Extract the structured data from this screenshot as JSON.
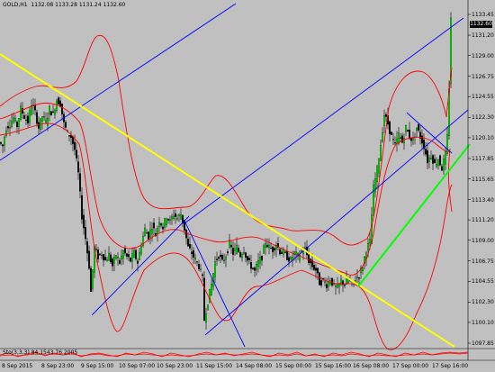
{
  "header": {
    "symbol_tf": "GOLD,H1",
    "ohlc": "1132.08 1133.28 1131.24 1132.60"
  },
  "price_axis": {
    "ticks": [
      "1133.45",
      "1131.20",
      "1129.00",
      "1126.75",
      "1124.55",
      "1122.30",
      "1120.10",
      "1117.85",
      "1115.65",
      "1113.40",
      "1111.20",
      "1109.00",
      "1106.75",
      "1104.55",
      "1102.30",
      "1100.10",
      "1097.85"
    ],
    "current_price": "1132.60"
  },
  "time_axis": {
    "labels": [
      "8 Sep 2015",
      "8 Sep 23:00",
      "9 Sep 15:00",
      "10 Sep 07:00",
      "10 Sep 23:00",
      "11 Sep 15:00",
      "14 Sep 08:00",
      "15 Sep 00:00",
      "15 Sep 16:00",
      "16 Sep 08:00",
      "17 Sep 00:00",
      "17 Sep 16:00"
    ]
  },
  "sub_window": {
    "label": "Sto(3,3,3) 84.1543 76.2005"
  },
  "colors": {
    "background": "#c0c0c0",
    "bull_candle": "#00ff00",
    "bear_candle": "#000000",
    "bands": "#ff0000",
    "channel": "#0000ff",
    "trend_yellow": "#ffff00",
    "trend_green": "#00ff00"
  },
  "chart_data": {
    "type": "candlestick",
    "title": "GOLD,H1",
    "ylim": [
      1097.0,
      1134.5
    ],
    "close_path": [
      [
        0,
        1119.6
      ],
      [
        4,
        1119.2
      ],
      [
        8,
        1121.2
      ],
      [
        12,
        1121.6
      ],
      [
        16,
        1122.2
      ],
      [
        20,
        1121.4
      ],
      [
        24,
        1123.2
      ],
      [
        28,
        1122.4
      ],
      [
        32,
        1121.8
      ],
      [
        36,
        1123.8
      ],
      [
        40,
        1122.8
      ],
      [
        44,
        1121.2
      ],
      [
        48,
        1122.4
      ],
      [
        52,
        1121.8
      ],
      [
        56,
        1123.2
      ],
      [
        60,
        1122.6
      ],
      [
        64,
        1124.2
      ],
      [
        68,
        1123.8
      ],
      [
        72,
        1121.6
      ],
      [
        76,
        1120.6
      ],
      [
        80,
        1120.2
      ],
      [
        84,
        1118.8
      ],
      [
        88,
        1116.2
      ],
      [
        92,
        1111.6
      ],
      [
        96,
        1109.2
      ],
      [
        100,
        1106.2
      ],
      [
        102,
        1103.4
      ],
      [
        106,
        1108.2
      ],
      [
        110,
        1107.2
      ],
      [
        114,
        1107.6
      ],
      [
        118,
        1106.8
      ],
      [
        122,
        1107.4
      ],
      [
        126,
        1106.2
      ],
      [
        130,
        1107.4
      ],
      [
        134,
        1106.6
      ],
      [
        138,
        1107.8
      ],
      [
        142,
        1107.2
      ],
      [
        146,
        1106.8
      ],
      [
        150,
        1107.6
      ],
      [
        154,
        1106.6
      ],
      [
        158,
        1108.6
      ],
      [
        162,
        1110.2
      ],
      [
        166,
        1109.4
      ],
      [
        170,
        1110.6
      ],
      [
        174,
        1109.6
      ],
      [
        178,
        1111.2
      ],
      [
        182,
        1110.4
      ],
      [
        186,
        1111.6
      ],
      [
        190,
        1111.0
      ],
      [
        194,
        1111.8
      ],
      [
        198,
        1111.4
      ],
      [
        202,
        1111.8
      ],
      [
        206,
        1110.2
      ],
      [
        210,
        1108.2
      ],
      [
        214,
        1107.6
      ],
      [
        218,
        1106.8
      ],
      [
        222,
        1106.2
      ],
      [
        226,
        1104.8
      ],
      [
        228,
        1100.4
      ],
      [
        232,
        1102.4
      ],
      [
        236,
        1104.2
      ],
      [
        240,
        1106.6
      ],
      [
        244,
        1107.4
      ],
      [
        248,
        1106.6
      ],
      [
        252,
        1107.4
      ],
      [
        256,
        1108.6
      ],
      [
        260,
        1107.6
      ],
      [
        264,
        1108.2
      ],
      [
        268,
        1107.4
      ],
      [
        272,
        1108.0
      ],
      [
        276,
        1106.8
      ],
      [
        280,
        1106.2
      ],
      [
        284,
        1105.6
      ],
      [
        288,
        1106.6
      ],
      [
        292,
        1107.2
      ],
      [
        296,
        1108.8
      ],
      [
        300,
        1108.2
      ],
      [
        304,
        1108.0
      ],
      [
        308,
        1108.6
      ],
      [
        312,
        1107.8
      ],
      [
        316,
        1107.6
      ],
      [
        320,
        1107.2
      ],
      [
        324,
        1106.8
      ],
      [
        328,
        1107.6
      ],
      [
        332,
        1107.2
      ],
      [
        336,
        1107.8
      ],
      [
        340,
        1108.0
      ],
      [
        344,
        1106.8
      ],
      [
        348,
        1106.2
      ],
      [
        352,
        1105.8
      ],
      [
        356,
        1104.4
      ],
      [
        360,
        1104.6
      ],
      [
        364,
        1104.2
      ],
      [
        368,
        1104.8
      ],
      [
        372,
        1104.0
      ],
      [
        376,
        1103.8
      ],
      [
        380,
        1104.6
      ],
      [
        384,
        1104.2
      ],
      [
        388,
        1104.8
      ],
      [
        392,
        1104.2
      ],
      [
        396,
        1104.8
      ],
      [
        400,
        1105.2
      ],
      [
        404,
        1106.2
      ],
      [
        408,
        1108.0
      ],
      [
        412,
        1108.8
      ],
      [
        416,
        1114.6
      ],
      [
        420,
        1116.6
      ],
      [
        424,
        1119.4
      ],
      [
        428,
        1122.6
      ],
      [
        432,
        1121.6
      ],
      [
        436,
        1120.2
      ],
      [
        440,
        1119.2
      ],
      [
        444,
        1120.4
      ],
      [
        448,
        1119.6
      ],
      [
        452,
        1121.2
      ],
      [
        456,
        1120.2
      ],
      [
        460,
        1119.8
      ],
      [
        464,
        1121.2
      ],
      [
        468,
        1120.2
      ],
      [
        472,
        1119.2
      ],
      [
        476,
        1117.6
      ],
      [
        480,
        1118.2
      ],
      [
        484,
        1117.2
      ],
      [
        488,
        1117.8
      ],
      [
        492,
        1116.8
      ],
      [
        496,
        1118.2
      ],
      [
        498,
        1120.2
      ],
      [
        500,
        1125.6
      ],
      [
        502,
        1133.2
      ]
    ]
  }
}
